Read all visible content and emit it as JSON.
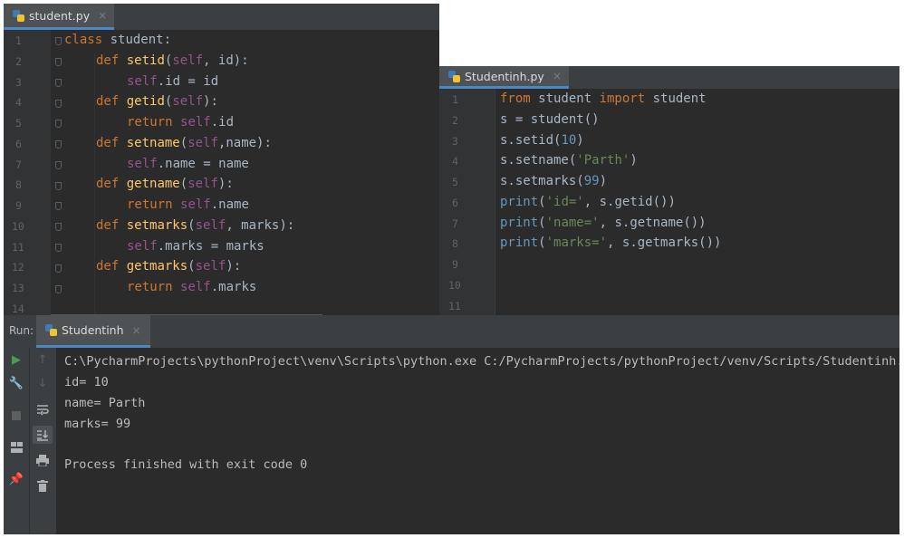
{
  "editor_left": {
    "tab": {
      "label": "student.py",
      "close": "×"
    },
    "line_numbers": [
      "1",
      "2",
      "3",
      "4",
      "5",
      "6",
      "7",
      "8",
      "9",
      "10",
      "11",
      "12",
      "13",
      "14"
    ]
  },
  "editor_right": {
    "tab": {
      "label": "Studentinh.py",
      "close": "×"
    },
    "line_numbers": [
      "1",
      "2",
      "3",
      "4",
      "5",
      "6",
      "7",
      "8",
      "9",
      "10",
      "11"
    ]
  },
  "code_left": {
    "l1_kw": "class",
    "l1_rest": " student:",
    "def": "def",
    "setid": "setid",
    "setid_self": "self",
    "setid_args": ", id):",
    "l3_self": "self",
    "l3_rest": ".id = id",
    "getid": "getid",
    "getid_self": "self",
    "getid_end": "):",
    "return": "return",
    "l5_self": "self",
    "l5_rest": ".id",
    "setname": "setname",
    "setname_self": "self",
    "setname_args": ",name):",
    "l7_self": "self",
    "l7_rest": ".name = name",
    "getname": "getname",
    "getname_self": "self",
    "getname_end": "):",
    "l9_self": "self",
    "l9_rest": ".name",
    "setmarks": "setmarks",
    "setmarks_self": "self",
    "setmarks_args": ", marks):",
    "l11_self": "self",
    "l11_rest": ".marks = marks",
    "getmarks": "getmarks",
    "getmarks_self": "self",
    "getmarks_end": "):",
    "l13_self": "self",
    "l13_rest": ".marks",
    "open_paren": "("
  },
  "code_right": {
    "from": "from",
    "mod": " student ",
    "import": "import",
    "cls": " student",
    "l2": "s = student()",
    "l3_a": "s.setid(",
    "l3_num": "10",
    "l3_b": ")",
    "l4_a": "s.setname(",
    "l4_str": "'Parth'",
    "l4_b": ")",
    "l5_a": "s.setmarks(",
    "l5_num": "99",
    "l5_b": ")",
    "print": "print",
    "paren": "(",
    "l6_str": "'id='",
    "l6_rest": ", s.getid())",
    "l7_str": "'name='",
    "l7_rest": ", s.getname())",
    "l8_str": "'marks='",
    "l8_rest": ", s.getmarks())"
  },
  "run": {
    "label": "Run:",
    "tab_label": "Studentinh",
    "tab_close": "×",
    "output": [
      "C:\\PycharmProjects\\pythonProject\\venv\\Scripts\\python.exe C:/PycharmProjects/pythonProject/venv/Scripts/Studentinh.py",
      "id= 10",
      "name= Parth",
      "marks= 99",
      "",
      "Process finished with exit code 0"
    ]
  },
  "colors": {
    "editor_bg": "#2b2b2b",
    "keyword": "#cc7832",
    "function": "#ffc66d",
    "self": "#94558d",
    "string": "#6a8759",
    "number": "#6897bb",
    "run_green": "#499c54"
  },
  "icons": {
    "left_tools": [
      "run-icon",
      "wrench-icon",
      "stop-icon",
      "layout-icon",
      "pin-icon"
    ],
    "right_tools": [
      "arrow-up-icon",
      "arrow-down-icon",
      "soft-wrap-icon",
      "scroll-to-end-icon",
      "print-icon",
      "trash-icon"
    ]
  }
}
